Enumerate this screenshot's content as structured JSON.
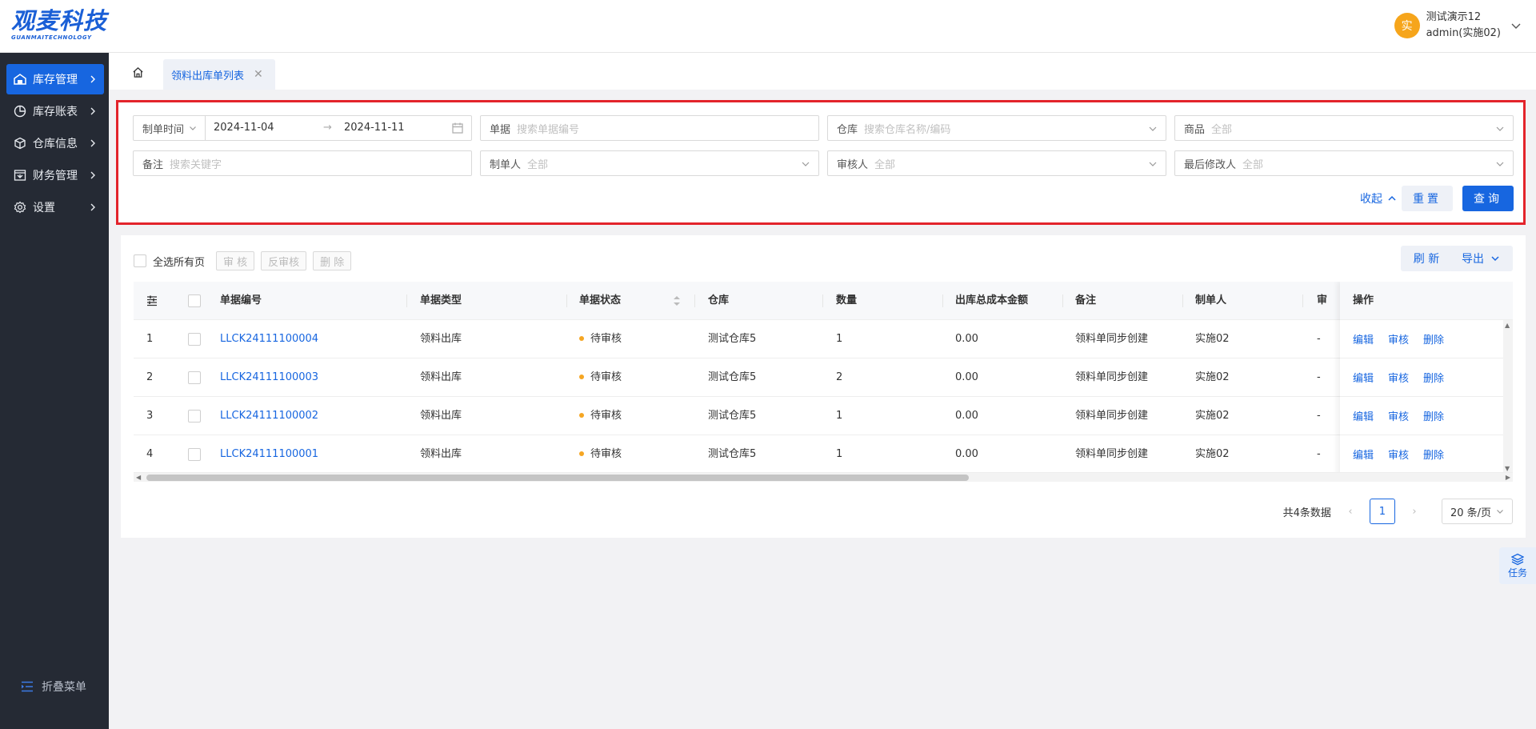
{
  "brand": {
    "name_cn": "观麦科技",
    "name_en": "GUANMAITECHNOLOGY"
  },
  "user": {
    "avatar_char": "实",
    "name": "测试演示12",
    "account": "admin(实施02)"
  },
  "sidebar": {
    "items": [
      {
        "label": "库存管理",
        "icon": "warehouse-icon",
        "active": true
      },
      {
        "label": "库存账表",
        "icon": "pie-chart-icon",
        "active": false
      },
      {
        "label": "仓库信息",
        "icon": "cube-icon",
        "active": false
      },
      {
        "label": "财务管理",
        "icon": "finance-icon",
        "active": false
      },
      {
        "label": "设置",
        "icon": "gear-icon",
        "active": false
      }
    ],
    "collapse_label": "折叠菜单"
  },
  "tabs": {
    "active_label": "领料出库单列表"
  },
  "filters": {
    "date_type": "制单时间",
    "date_start": "2024-11-04",
    "date_end": "2024-11-11",
    "doc_label": "单据",
    "doc_placeholder": "搜索单据编号",
    "warehouse_label": "仓库",
    "warehouse_placeholder": "搜索仓库名称/编码",
    "goods_label": "商品",
    "goods_value": "全部",
    "remark_label": "备注",
    "remark_placeholder": "搜索关键字",
    "creator_label": "制单人",
    "creator_value": "全部",
    "auditor_label": "审核人",
    "auditor_value": "全部",
    "modifier_label": "最后修改人",
    "modifier_value": "全部",
    "collapse_label": "收起",
    "reset_label": "重置",
    "query_label": "查询"
  },
  "toolbar": {
    "select_all_label": "全选所有页",
    "audit_label": "审 核",
    "unaudit_label": "反审核",
    "delete_label": "删 除",
    "refresh_label": "刷 新",
    "export_label": "导出"
  },
  "table": {
    "columns": [
      "单据编号",
      "单据类型",
      "单据状态",
      "仓库",
      "数量",
      "出库总成本金额",
      "备注",
      "制单人",
      "审",
      "操作"
    ],
    "rows": [
      {
        "idx": "1",
        "code": "LLCK24111100004",
        "type": "领料出库",
        "status": "待审核",
        "warehouse": "测试仓库5",
        "qty": "1",
        "cost": "0.00",
        "remark": "领料单同步创建",
        "creator": "实施02",
        "auditor": "-"
      },
      {
        "idx": "2",
        "code": "LLCK24111100003",
        "type": "领料出库",
        "status": "待审核",
        "warehouse": "测试仓库5",
        "qty": "2",
        "cost": "0.00",
        "remark": "领料单同步创建",
        "creator": "实施02",
        "auditor": "-"
      },
      {
        "idx": "3",
        "code": "LLCK24111100002",
        "type": "领料出库",
        "status": "待审核",
        "warehouse": "测试仓库5",
        "qty": "1",
        "cost": "0.00",
        "remark": "领料单同步创建",
        "creator": "实施02",
        "auditor": "-"
      },
      {
        "idx": "4",
        "code": "LLCK24111100001",
        "type": "领料出库",
        "status": "待审核",
        "warehouse": "测试仓库5",
        "qty": "1",
        "cost": "0.00",
        "remark": "领料单同步创建",
        "creator": "实施02",
        "auditor": "-"
      }
    ],
    "row_actions": {
      "edit": "编辑",
      "audit": "审核",
      "delete": "删除"
    }
  },
  "pagination": {
    "total_text": "共4条数据",
    "current_page": "1",
    "page_size": "20 条/页"
  },
  "task_label": "任务",
  "colors": {
    "primary": "#1766e0",
    "sidebar_bg": "#252a34",
    "pending_dot": "#f5a623",
    "highlight_border": "#e3242b",
    "avatar": "#f6a51b"
  }
}
